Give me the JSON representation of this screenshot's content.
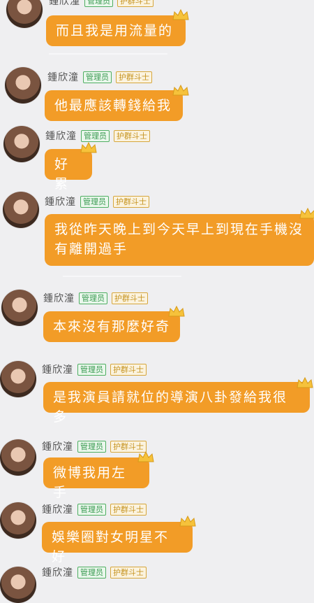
{
  "sender": {
    "name": "鍾欣潼",
    "tag_admin": "管理员",
    "tag_guard": "护群斗士"
  },
  "messages": [
    {
      "text": "而且我是用流量的"
    },
    {
      "text": "他最應該轉錢給我"
    },
    {
      "text": "好累"
    },
    {
      "text": "我從昨天晚上到今天早上到現在手機沒有離開過手"
    },
    {
      "text": "本來沒有那麼好奇"
    },
    {
      "text": "是我演員請就位的導演八卦發給我很多"
    },
    {
      "text": "微博我用左手"
    },
    {
      "text": "娛樂圈對女明星不好"
    },
    {
      "text": ""
    }
  ],
  "colors": {
    "bubble": "#f29c27",
    "admin_tag": "#4fae62",
    "guard_tag": "#d6a63c",
    "background": "#efeff1"
  },
  "icons": {
    "crown": "crown-icon"
  }
}
